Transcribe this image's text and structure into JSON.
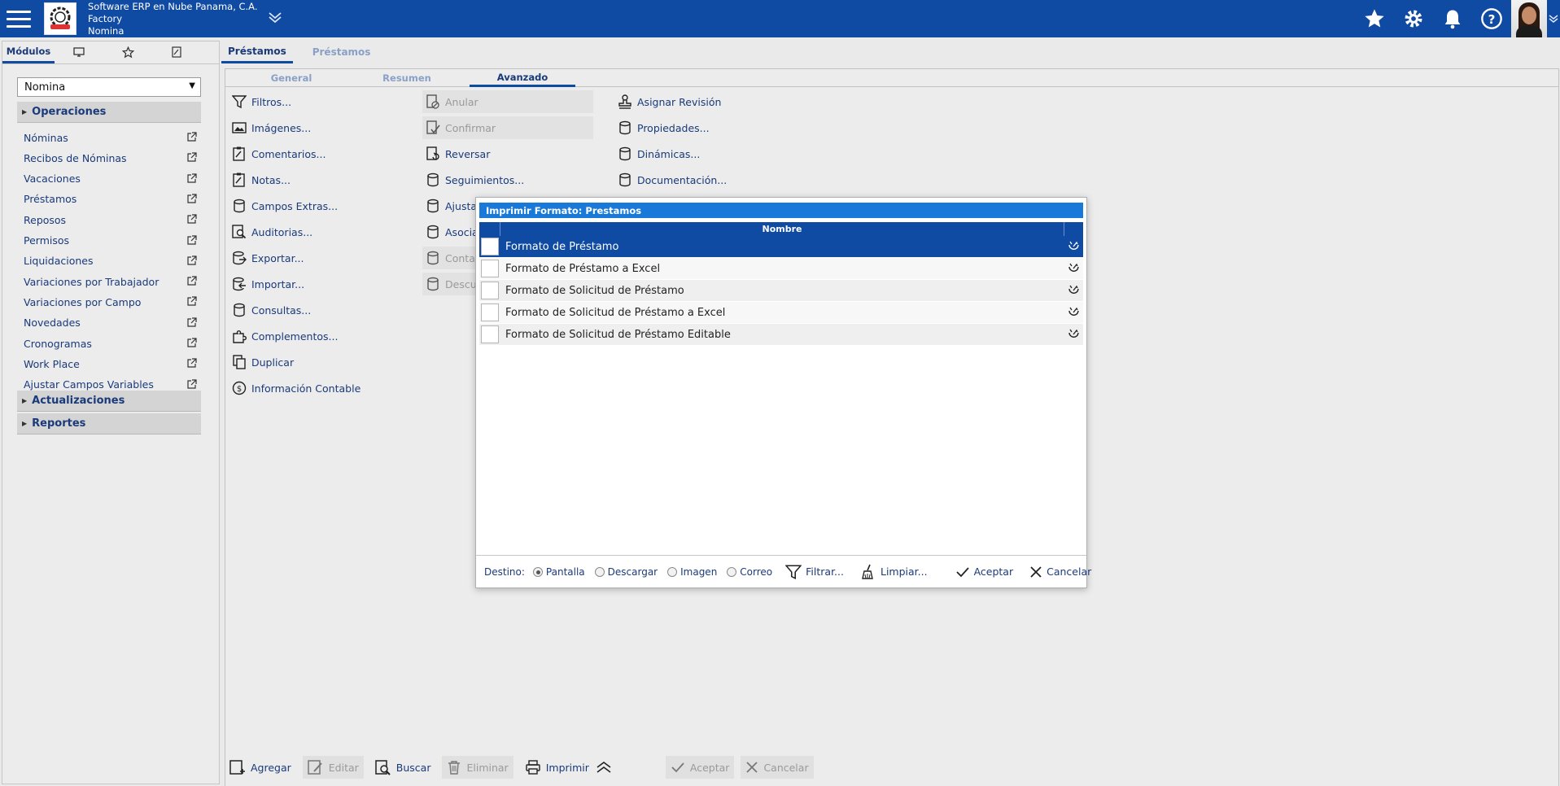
{
  "company": {
    "line1": "Software ERP en Nube Panama, C.A.",
    "line2": "Factory",
    "line3": "Nomina"
  },
  "left": {
    "tabs": [
      {
        "label": "Módulos",
        "icon": "text"
      },
      {
        "label": "",
        "icon": "monitor-icon"
      },
      {
        "label": "",
        "icon": "star-icon"
      },
      {
        "label": "",
        "icon": "edit-icon"
      }
    ],
    "module_select": "Nomina",
    "sections": {
      "operaciones": "Operaciones",
      "actualizaciones": "Actualizaciones",
      "reportes": "Reportes"
    },
    "items": [
      "Nóminas",
      "Recibos de Nóminas",
      "Vacaciones",
      "Préstamos",
      "Reposos",
      "Permisos",
      "Liquidaciones",
      "Variaciones por Trabajador",
      "Variaciones por Campo",
      "Novedades",
      "Cronogramas",
      "Work Place",
      "Ajustar Campos Variables"
    ]
  },
  "main": {
    "tabs": [
      "Préstamos",
      "Préstamos"
    ],
    "subtabs": [
      "General",
      "Resumen",
      "Avanzado"
    ],
    "col1": [
      "Filtros...",
      "Imágenes...",
      "Comentarios...",
      "Notas...",
      "Campos Extras...",
      "Auditorias...",
      "Exportar...",
      "Importar...",
      "Consultas...",
      "Complementos...",
      "Duplicar",
      "Información Contable"
    ],
    "col2": [
      "Anular",
      "Confirmar",
      "Reversar",
      "Seguimientos...",
      "Ajusta",
      "Asocia",
      "Conta",
      "Descu"
    ],
    "col3": [
      "Asignar Revisión",
      "Propiedades...",
      "Dinámicas...",
      "Documentación..."
    ]
  },
  "bottom": {
    "agregar": "Agregar",
    "editar": "Editar",
    "buscar": "Buscar",
    "eliminar": "Eliminar",
    "imprimir": "Imprimir",
    "aceptar": "Aceptar",
    "cancelar": "Cancelar"
  },
  "dialog": {
    "title": "Imprimir Formato: Prestamos",
    "column": "Nombre",
    "rows": [
      "Formato de Préstamo",
      "Formato de Préstamo a Excel",
      "Formato de Solicitud de Préstamo",
      "Formato de Solicitud de Préstamo a Excel",
      "Formato de Solicitud de Préstamo Editable"
    ],
    "destino_label": "Destino:",
    "options": [
      "Pantalla",
      "Descargar",
      "Imagen",
      "Correo"
    ],
    "filtrar": "Filtrar...",
    "limpiar": "Limpiar...",
    "aceptar": "Aceptar",
    "cancelar": "Cancelar"
  },
  "colors": {
    "topbar": "#0f4aa3",
    "dialog_title": "#1879d8",
    "selected_row": "#0f4aa3",
    "link_text": "#1a3a7a"
  }
}
